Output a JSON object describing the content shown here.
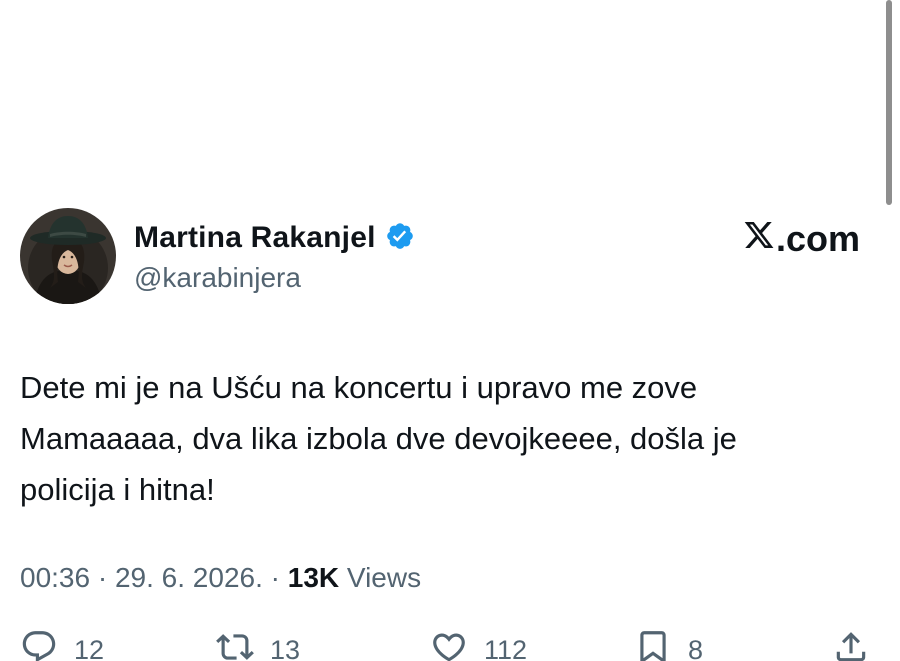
{
  "author": {
    "display_name": "Martina Rakanjel",
    "username": "@karabinjera",
    "verified": true
  },
  "brand": {
    "label": ".com",
    "icon": "x-logo-icon"
  },
  "tweet": {
    "text_lines": [
      "Dete mi je na Ušću na koncertu i upravo me zove",
      "Mamaaaaa, dva lika izbola dve devojkeeee, došla je",
      "policija i hitna!"
    ]
  },
  "meta": {
    "time": "00:36",
    "separator": " · ",
    "date": "29. 6. 2026.",
    "views_count": "13K",
    "views_label": " Views"
  },
  "actions": {
    "replies": "12",
    "reposts": "13",
    "likes": "112",
    "bookmarks": "8"
  },
  "colors": {
    "text_primary": "#0f1419",
    "text_secondary": "#536471",
    "verified_blue": "#1d9bf0",
    "background": "#ffffff"
  },
  "icons": [
    "verified-badge-icon",
    "x-logo-icon",
    "reply-icon",
    "repost-icon",
    "like-icon",
    "bookmark-icon",
    "share-icon"
  ]
}
